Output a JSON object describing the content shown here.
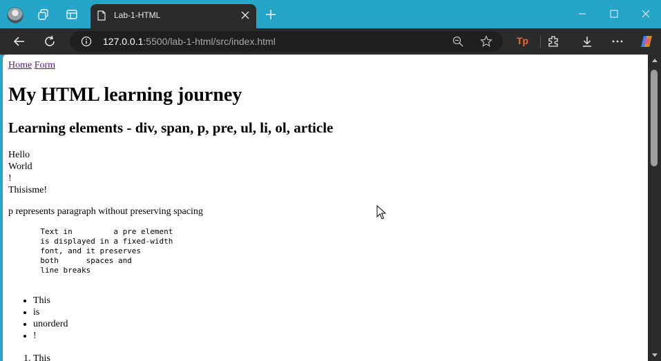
{
  "browser": {
    "tab_title": "Lab-1-HTML",
    "url_host": "127.0.0.1",
    "url_rest": ":5500/lab-1-html/src/index.html",
    "accent_color": "#25a5c8",
    "icons": [
      "profile-avatar",
      "workspaces-icon",
      "tab-actions-icon",
      "document-icon",
      "close-icon",
      "plus-icon",
      "minimize-icon",
      "maximize-icon",
      "close-window-icon",
      "back-icon",
      "refresh-icon",
      "info-icon",
      "zoom-out-icon",
      "star-icon",
      "extensions-icon",
      "download-icon",
      "more-icon",
      "copilot-icon"
    ],
    "extension_label": "Tp"
  },
  "page": {
    "nav": [
      "Home",
      "Form"
    ],
    "h1": "My HTML learning journey",
    "h2": "Learning elements - div, span, p, pre, ul, li, ol, article",
    "lines": [
      "Hello",
      "World",
      "!",
      "Thisisme!"
    ],
    "paragraph": "p represents paragraph without preserving spacing",
    "pre_text": "       Text in         a pre element\n       is displayed in a fixed-width\n       font, and it preserves\n       both      spaces and\n       line breaks",
    "ul_items": [
      "This",
      "is",
      "unorderd",
      "!"
    ],
    "ol_items": [
      "This"
    ]
  }
}
